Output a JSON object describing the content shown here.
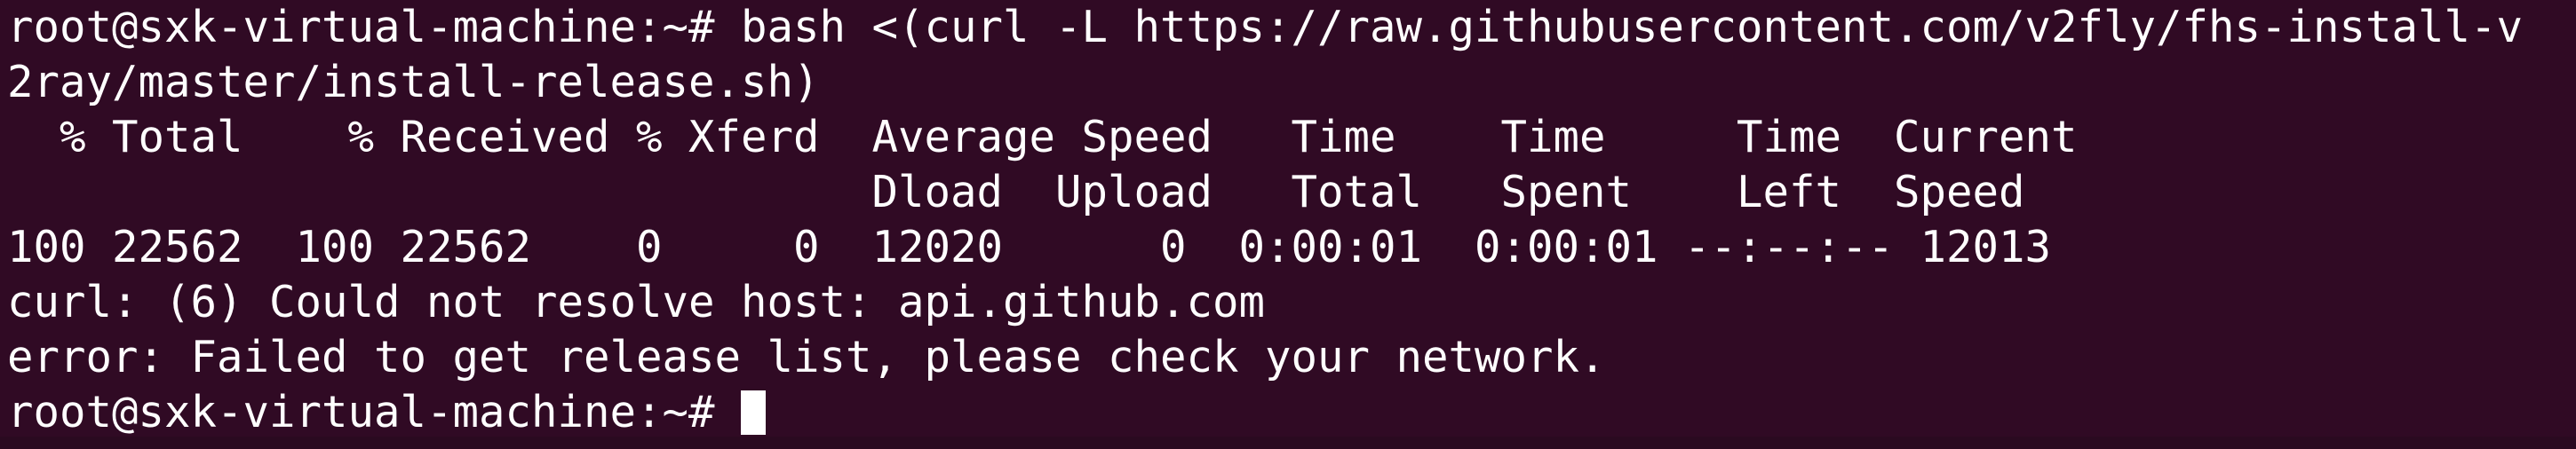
{
  "terminal": {
    "lines": [
      "root@sxk-virtual-machine:~# bash <(curl -L https://raw.githubusercontent.com/v2fly/fhs-install-v",
      "2ray/master/install-release.sh)",
      "  % Total    % Received % Xferd  Average Speed   Time    Time     Time  Current",
      "                                 Dload  Upload   Total   Spent    Left  Speed",
      "100 22562  100 22562    0     0  12020      0  0:00:01  0:00:01 --:--:-- 12013",
      "curl: (6) Could not resolve host: api.github.com",
      "error: Failed to get release list, please check your network.",
      "root@sxk-virtual-machine:~# "
    ]
  },
  "colors": {
    "background": "#300a24",
    "text": "#ffffff"
  }
}
